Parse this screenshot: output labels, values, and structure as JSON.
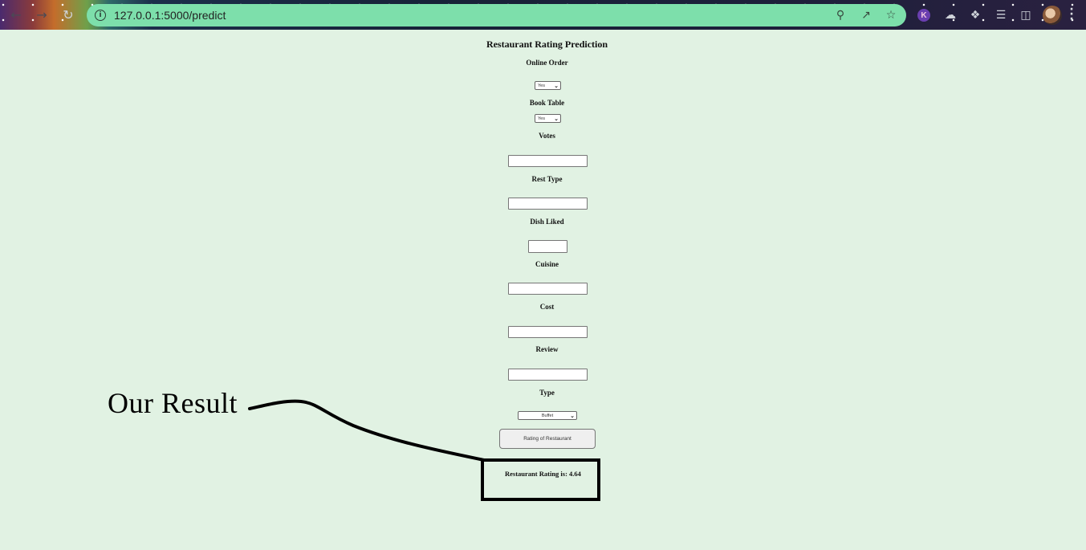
{
  "browser": {
    "url": "127.0.0.1:5000/predict",
    "nav_icons": [
      "back-arrow-icon",
      "forward-arrow-icon",
      "reload-icon"
    ],
    "omnibox_icons": [
      "zoom-out-icon",
      "share-icon",
      "star-icon"
    ],
    "extension_k": "K",
    "toolbar_icons": [
      "extension-cloud-icon",
      "puzzle-icon",
      "media-list-icon",
      "side-panel-icon"
    ]
  },
  "page": {
    "title": "Restaurant Rating Prediction",
    "fields": {
      "online_order": {
        "label": "Online Order",
        "value": "Yes"
      },
      "book_table": {
        "label": "Book Table",
        "value": "Yes"
      },
      "votes": {
        "label": "Votes"
      },
      "rest_type": {
        "label": "Rest Type"
      },
      "dish_liked": {
        "label": "Dish Liked"
      },
      "cuisine": {
        "label": "Cuisine"
      },
      "cost": {
        "label": "Cost"
      },
      "review": {
        "label": "Review"
      },
      "type": {
        "label": "Type",
        "value": "Buffet"
      }
    },
    "submit_label": "Rating of Restaurant",
    "result_text": "Restaurant Rating is: 4.64"
  },
  "annotation": {
    "label": "Our Result"
  }
}
